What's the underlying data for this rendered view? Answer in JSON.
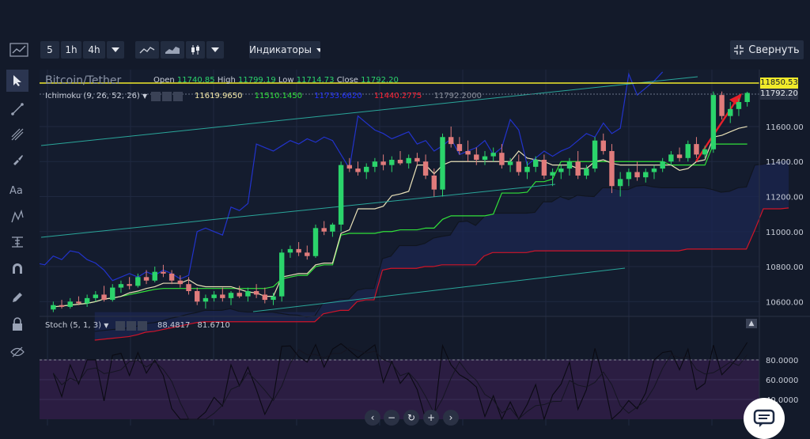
{
  "toolbar": {
    "timeframes": [
      "5",
      "1h",
      "4h"
    ],
    "indicators_label": "Индикаторы",
    "collapse_label": "Свернуть"
  },
  "legend": {
    "symbol": "Bitcoin/Tether",
    "open_label": "Open",
    "open": "11740.85",
    "high_label": "High",
    "high": "11799.19",
    "low_label": "Low",
    "low": "11714.73",
    "close_label": "Close",
    "close": "11792.20",
    "ichimoku_name": "Ichimoku (9, 26, 52, 26)",
    "ichimoku_values": [
      "11619.9650",
      "11510.1450",
      "11733.6620",
      "11440.2775",
      "11792.2000"
    ],
    "ichimoku_colors": [
      "#f5e9a8",
      "#31e13a",
      "#2233ff",
      "#ff2233",
      "#8a8f9a"
    ],
    "stoch_name": "Stoch (5, 1, 3)",
    "stoch_values": [
      "88.4817",
      "81.6710"
    ]
  },
  "price_markers": {
    "resistance": "11850.53",
    "last": "11792.20"
  },
  "colors": {
    "bg": "#131a2a",
    "up": "#2bd46b",
    "down": "#e07b7b",
    "resistance": "#f0ea2a",
    "channel": "#2aa69a",
    "cloud": "#1b2550",
    "stoch_bg": "#2b1d42",
    "arrow": "#e8202a"
  },
  "chart_data": {
    "type": "candlestick",
    "title": "Bitcoin/Tether",
    "y_ticks": [
      10600,
      10800,
      11000,
      11200,
      11400,
      11600
    ],
    "ylim": [
      10520,
      11880
    ],
    "candles": [
      [
        10555,
        10600,
        10540,
        10580
      ],
      [
        10580,
        10610,
        10560,
        10570
      ],
      [
        10570,
        10620,
        10560,
        10600
      ],
      [
        10600,
        10630,
        10580,
        10590
      ],
      [
        10590,
        10640,
        10570,
        10620
      ],
      [
        10620,
        10660,
        10600,
        10640
      ],
      [
        10640,
        10690,
        10600,
        10610
      ],
      [
        10610,
        10700,
        10600,
        10680
      ],
      [
        10680,
        10720,
        10650,
        10700
      ],
      [
        10700,
        10740,
        10670,
        10690
      ],
      [
        10690,
        10760,
        10680,
        10740
      ],
      [
        10740,
        10780,
        10700,
        10720
      ],
      [
        10720,
        10800,
        10710,
        10770
      ],
      [
        10770,
        10810,
        10740,
        10760
      ],
      [
        10760,
        10780,
        10700,
        10720
      ],
      [
        10720,
        10750,
        10680,
        10700
      ],
      [
        10700,
        10740,
        10640,
        10660
      ],
      [
        10660,
        10680,
        10580,
        10600
      ],
      [
        10600,
        10640,
        10560,
        10620
      ],
      [
        10620,
        10660,
        10600,
        10640
      ],
      [
        10640,
        10680,
        10600,
        10620
      ],
      [
        10620,
        10660,
        10580,
        10650
      ],
      [
        10650,
        10690,
        10620,
        10630
      ],
      [
        10630,
        10680,
        10600,
        10660
      ],
      [
        10660,
        10700,
        10620,
        10640
      ],
      [
        10640,
        10680,
        10590,
        10610
      ],
      [
        10610,
        10650,
        10580,
        10630
      ],
      [
        10630,
        10900,
        10600,
        10880
      ],
      [
        10880,
        10920,
        10850,
        10900
      ],
      [
        10900,
        10940,
        10860,
        10880
      ],
      [
        10880,
        10920,
        10840,
        10860
      ],
      [
        10860,
        11040,
        10850,
        11020
      ],
      [
        11020,
        11060,
        10980,
        11000
      ],
      [
        11000,
        11050,
        10970,
        11040
      ],
      [
        11040,
        11400,
        11000,
        11380
      ],
      [
        11380,
        11420,
        11340,
        11360
      ],
      [
        11360,
        11400,
        11320,
        11340
      ],
      [
        11340,
        11390,
        11300,
        11370
      ],
      [
        11370,
        11420,
        11340,
        11400
      ],
      [
        11400,
        11440,
        11350,
        11380
      ],
      [
        11380,
        11430,
        11340,
        11410
      ],
      [
        11410,
        11460,
        11380,
        11390
      ],
      [
        11390,
        11440,
        11360,
        11420
      ],
      [
        11420,
        11450,
        11380,
        11400
      ],
      [
        11400,
        11440,
        11300,
        11320
      ],
      [
        11320,
        11360,
        11200,
        11240
      ],
      [
        11240,
        11560,
        11200,
        11540
      ],
      [
        11540,
        11600,
        11480,
        11500
      ],
      [
        11500,
        11540,
        11440,
        11460
      ],
      [
        11460,
        11520,
        11400,
        11440
      ],
      [
        11440,
        11480,
        11380,
        11410
      ],
      [
        11410,
        11460,
        11380,
        11430
      ],
      [
        11430,
        11480,
        11400,
        11450
      ],
      [
        11450,
        11500,
        11360,
        11380
      ],
      [
        11380,
        11420,
        11340,
        11400
      ],
      [
        11400,
        11440,
        11320,
        11340
      ],
      [
        11340,
        11400,
        11300,
        11370
      ],
      [
        11370,
        11430,
        11340,
        11410
      ],
      [
        11410,
        11440,
        11300,
        11320
      ],
      [
        11320,
        11360,
        11260,
        11340
      ],
      [
        11340,
        11380,
        11300,
        11360
      ],
      [
        11360,
        11420,
        11320,
        11400
      ],
      [
        11400,
        11460,
        11300,
        11320
      ],
      [
        11320,
        11380,
        11300,
        11360
      ],
      [
        11360,
        11540,
        11340,
        11520
      ],
      [
        11520,
        11560,
        11440,
        11460
      ],
      [
        11460,
        11500,
        11220,
        11260
      ],
      [
        11260,
        11340,
        11200,
        11300
      ],
      [
        11300,
        11360,
        11260,
        11340
      ],
      [
        11340,
        11400,
        11290,
        11310
      ],
      [
        11310,
        11360,
        11280,
        11340
      ],
      [
        11340,
        11380,
        11300,
        11360
      ],
      [
        11360,
        11420,
        11340,
        11400
      ],
      [
        11400,
        11460,
        11380,
        11440
      ],
      [
        11440,
        11480,
        11400,
        11420
      ],
      [
        11420,
        11520,
        11400,
        11500
      ],
      [
        11500,
        11540,
        11420,
        11440
      ],
      [
        11440,
        11490,
        11420,
        11470
      ],
      [
        11470,
        11800,
        11450,
        11780
      ],
      [
        11780,
        11800,
        11640,
        11660
      ],
      [
        11660,
        11740,
        11620,
        11700
      ],
      [
        11700,
        11760,
        11660,
        11740
      ],
      [
        11740,
        11799,
        11714,
        11792
      ]
    ],
    "stoch_ticks": [
      40,
      60,
      80
    ],
    "stoch_ylim": [
      20,
      100
    ]
  }
}
